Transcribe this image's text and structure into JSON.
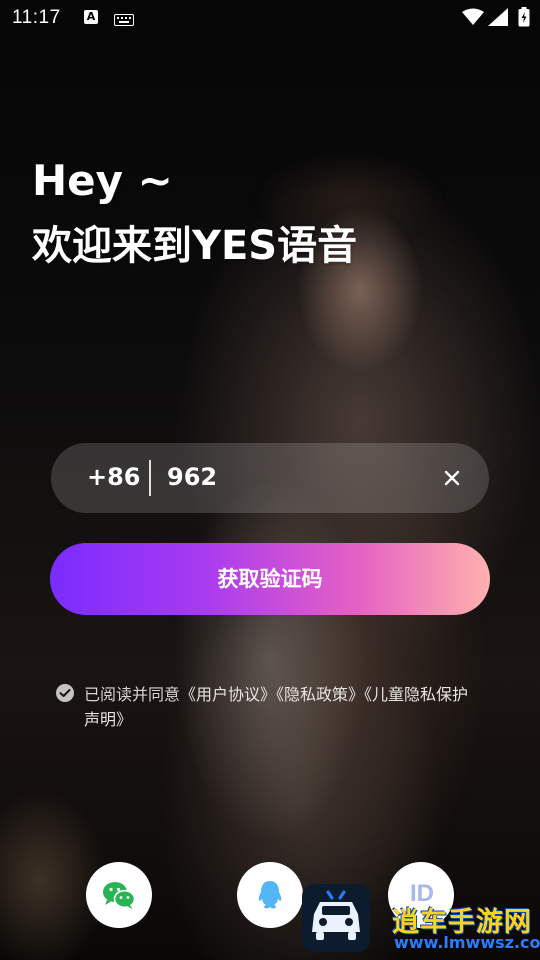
{
  "status_bar": {
    "time": "11:17",
    "icons": [
      "a-notification-icon",
      "keyboard-icon",
      "wifi-icon",
      "signal-icon",
      "battery-icon"
    ]
  },
  "greeting": {
    "line1": "Hey ~",
    "line2": "欢迎来到YES语音"
  },
  "phone_input": {
    "country_code": "+86",
    "value": "962",
    "clear_icon": "close-icon"
  },
  "get_code_button": {
    "label": "获取验证码"
  },
  "agreement": {
    "prefix": "已阅读并同意",
    "user_agreement": "《用户协议》",
    "privacy_policy": "《隐私政策》",
    "child_privacy": "《儿童隐私保护声明》",
    "checked": true
  },
  "social_login": [
    {
      "name": "wechat",
      "icon": "wechat-icon"
    },
    {
      "name": "qq",
      "icon": "qq-icon"
    },
    {
      "name": "id",
      "label": "ID"
    }
  ],
  "watermark": {
    "title": "逍车手游网",
    "url": "www.lmwwsz.com"
  },
  "colors": {
    "button_gradient_start": "#7a2cff",
    "button_gradient_end": "#ffb1ae",
    "watermark_title": "#ffd21e",
    "watermark_url": "#2b7cff"
  }
}
